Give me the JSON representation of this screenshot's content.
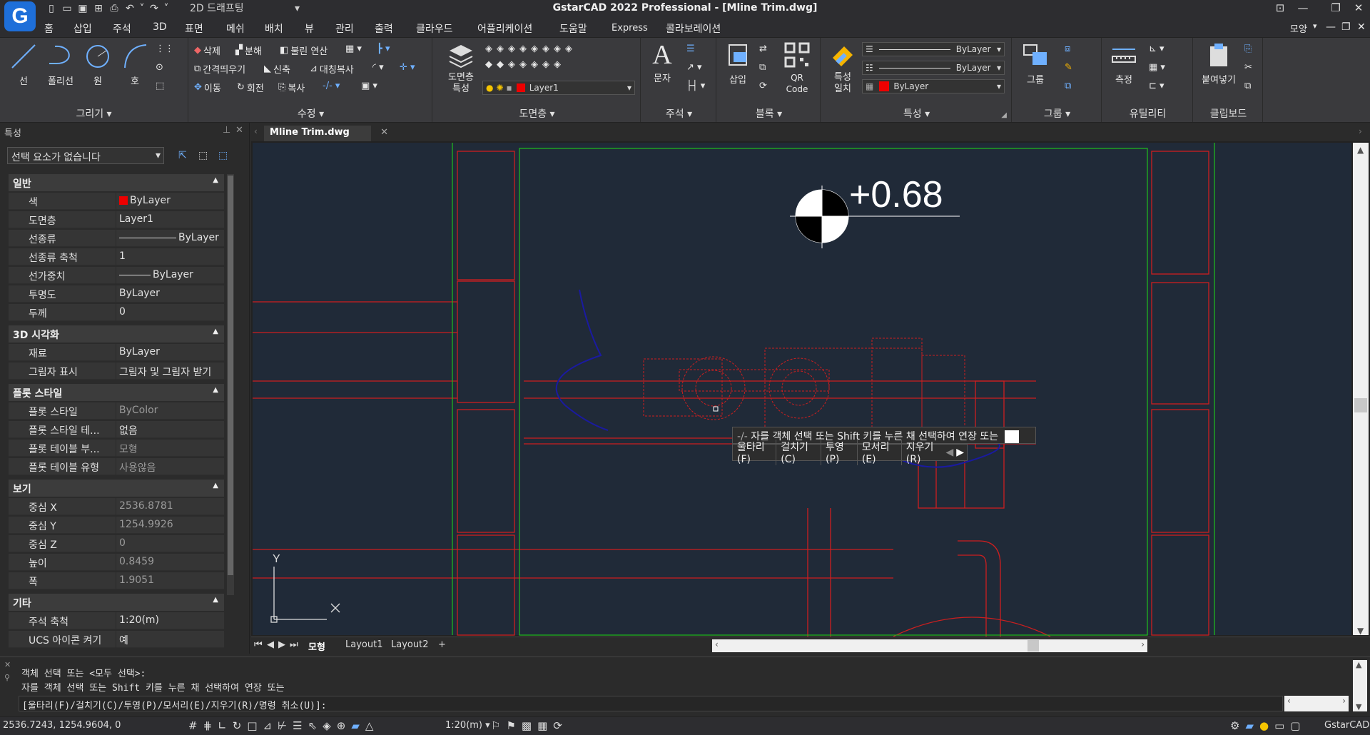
{
  "app": {
    "window_title": "GstarCAD 2022 Professional - [Mline Trim.dwg]",
    "logo_letter": "G",
    "workspace": "2D 드래프팅"
  },
  "menu": [
    "홈",
    "삽입",
    "주석",
    "3D",
    "표면",
    "메쉬",
    "배치",
    "뷰",
    "관리",
    "출력",
    "클라우드",
    "어플리케이션",
    "도움말",
    "Express",
    "콜라보레이션"
  ],
  "menu_right": "모양",
  "ribbon": {
    "draw": {
      "title": "그리기",
      "line": "선",
      "polyline": "폴리선",
      "circle": "원",
      "arc": "호"
    },
    "modify": {
      "title": "수정",
      "erase": "삭제",
      "explode": "분해",
      "boolean": "불린 연산",
      "offset": "간격띄우기",
      "stretch": "신축",
      "mirror": "대칭복사",
      "move": "이동",
      "rotate": "회전",
      "copy": "복사"
    },
    "layers": {
      "title": "도면층",
      "layer_props": "도면층\n특성",
      "current_layer": "Layer1"
    },
    "annotation": {
      "title": "주석",
      "text": "문자"
    },
    "block": {
      "title": "블록",
      "insert": "삽입",
      "qrcode": "QR\nCode"
    },
    "properties": {
      "title": "특성",
      "match": "특성\n일치",
      "color": "ByLayer",
      "linetype": "ByLayer",
      "lineweight": "ByLayer"
    },
    "group": {
      "title": "그룹",
      "group": "그룹"
    },
    "utility": {
      "title": "유틸리티",
      "measure": "측정"
    },
    "clipboard": {
      "title": "클립보드",
      "paste": "붙여넣기"
    }
  },
  "props_panel": {
    "title": "특성",
    "selection": "선택 요소가 없습니다",
    "sections": [
      {
        "name": "일반",
        "rows": [
          {
            "k": "색",
            "v": "ByLayer"
          },
          {
            "k": "도면층",
            "v": "Layer1"
          },
          {
            "k": "선종류",
            "v": "ByLayer"
          },
          {
            "k": "선종류 축척",
            "v": "1"
          },
          {
            "k": "선가중치",
            "v": "ByLayer"
          },
          {
            "k": "투명도",
            "v": "ByLayer"
          },
          {
            "k": "두께",
            "v": "0"
          }
        ]
      },
      {
        "name": "3D 시각화",
        "rows": [
          {
            "k": "재료",
            "v": "ByLayer"
          },
          {
            "k": "그림자 표시",
            "v": "그림자 및 그림자 받기"
          }
        ]
      },
      {
        "name": "플롯 스타일",
        "rows": [
          {
            "k": "플롯 스타일",
            "v": "ByColor"
          },
          {
            "k": "플롯 스타일 테...",
            "v": "없음"
          },
          {
            "k": "플롯 테이블 부...",
            "v": "모형"
          },
          {
            "k": "플롯 테이블 유형",
            "v": "사용않음"
          }
        ]
      },
      {
        "name": "보기",
        "rows": [
          {
            "k": "중심 X",
            "v": "2536.8781"
          },
          {
            "k": "중심 Y",
            "v": "1254.9926"
          },
          {
            "k": "중심 Z",
            "v": "0"
          },
          {
            "k": "높이",
            "v": "0.8459"
          },
          {
            "k": "폭",
            "v": "1.9051"
          }
        ]
      },
      {
        "name": "기타",
        "rows": [
          {
            "k": "주석 축척",
            "v": "1:20(m)"
          },
          {
            "k": "UCS 아이콘 켜기",
            "v": "예"
          }
        ]
      }
    ]
  },
  "document_tab": "Mline Trim.dwg",
  "drawing": {
    "elevation_label": "+0.68",
    "axis_y": "Y",
    "axis_x": "X"
  },
  "tooltip": {
    "prompt": "자를 객체 선택 또는 Shift 키를 누른 채 선택하여 연장 또는",
    "options": [
      "울타리(F)",
      "걸치기(C)",
      "투영(P)",
      "모서리(E)",
      "지우기(R)"
    ]
  },
  "layout_tabs": [
    "모형",
    "Layout1",
    "Layout2",
    "+"
  ],
  "command_history": [
    "객체 선택 또는 <모두 선택>:",
    "자를 객체 선택 또는 Shift 키를 누른 채 선택하여 연장 또는",
    "[울타리(F)/걸치기(C)/투영(P)/모서리(E)/지우기(R)/명령 취소(U)]:"
  ],
  "status": {
    "coords": "2536.7243, 1254.9604, 0",
    "annotation_scale": "1:20(m)",
    "brand": "GstarCAD"
  },
  "colors": {
    "canvas_bg": "#202a38",
    "red_line": "#cc1f1f",
    "green_line": "#1fbf1f",
    "blue_curve": "#1a1aa0",
    "white": "#ffffff"
  }
}
